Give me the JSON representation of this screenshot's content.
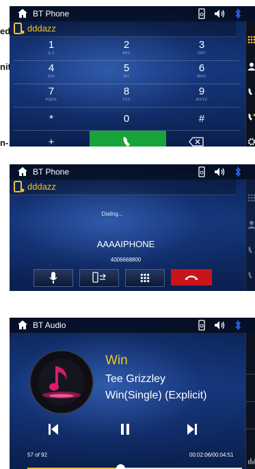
{
  "background_fragments": [
    "ed",
    "nit",
    "n-"
  ],
  "panel1": {
    "title": "BT Phone",
    "contact_name": "dddazz",
    "keys": [
      {
        "digit": "1",
        "letters": "Q.Z"
      },
      {
        "digit": "2",
        "letters": "ABC"
      },
      {
        "digit": "3",
        "letters": "DEF"
      },
      {
        "digit": "4",
        "letters": "GHI"
      },
      {
        "digit": "5",
        "letters": "JKL"
      },
      {
        "digit": "6",
        "letters": "MNO"
      },
      {
        "digit": "7",
        "letters": "PQRS"
      },
      {
        "digit": "8",
        "letters": "TUV"
      },
      {
        "digit": "9",
        "letters": "WXYZ"
      },
      {
        "digit": "*",
        "letters": ""
      },
      {
        "digit": "0",
        "letters": ""
      },
      {
        "digit": "#",
        "letters": ""
      }
    ],
    "plus_label": "+",
    "icons": [
      "home-icon",
      "phone-link-icon",
      "volume-icon",
      "bluetooth-icon",
      "call-icon",
      "backspace-icon",
      "dialpad-icon",
      "contacts-icon",
      "call-history-icon",
      "settings-icon"
    ]
  },
  "panel2": {
    "title": "BT Phone",
    "contact_name": "dddazz",
    "status": "Dialing...",
    "caller_name": "AAAAIPHONE",
    "caller_number": "4006668800",
    "icons": [
      "microphone-icon",
      "transfer-to-phone-icon",
      "dialpad-icon",
      "hang-up-icon"
    ]
  },
  "panel3": {
    "title": "BT Audio",
    "track_title": "Win",
    "artist": "Tee Grizzley",
    "album": "Win(Single) (Explicit)",
    "track_index": "57 of 92",
    "time": "00:02:06/00:04:51",
    "progress_fraction": 0.433,
    "icons": [
      "music-note-icon",
      "previous-track-icon",
      "pause-icon",
      "next-track-icon"
    ]
  },
  "colors": {
    "accent_yellow": "#f5c21a",
    "call_green": "#19a33b",
    "hangup_red": "#c9141b",
    "bluetooth_blue": "#2a6cff"
  }
}
